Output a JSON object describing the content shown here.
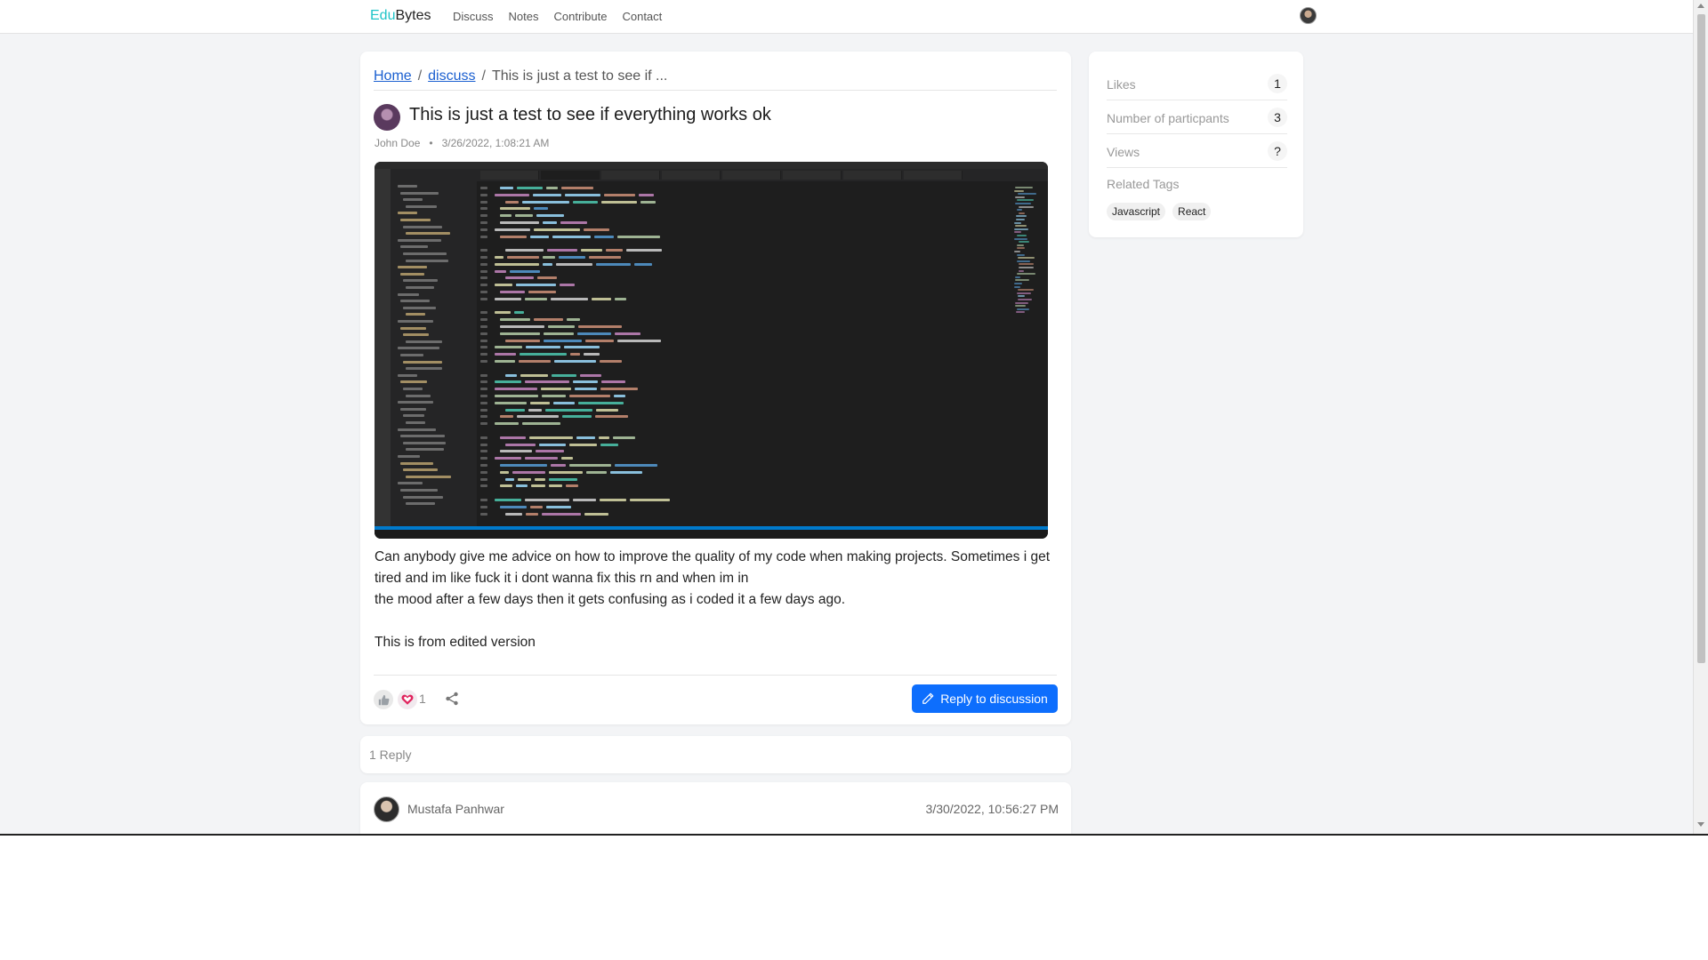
{
  "nav": {
    "brand_prefix": "Edu",
    "brand_suffix": "Bytes",
    "links": [
      "Discuss",
      "Notes",
      "Contribute",
      "Contact"
    ]
  },
  "breadcrumb": {
    "home": "Home",
    "discuss": "discuss",
    "current": "This is just a test to see if ..."
  },
  "post": {
    "title": "This is just a test to see if everything works ok",
    "author": "John Doe",
    "date": "3/26/2022, 1:08:21 AM",
    "body_line1": "Can anybody give me advice on how to improve the quality of my code when making projects. Sometimes i get tired and im like fuck it i dont wanna fix this rn and when im in",
    "body_line2": "the mood after a few days then it gets confusing as i coded it a few days ago.",
    "body_line3": "This is from edited version",
    "heart_count": "1",
    "reply_button": "Reply to discussion"
  },
  "replies": {
    "count_label": "1 Reply",
    "items": [
      {
        "author": "Mustafa Panhwar",
        "time": "3/30/2022, 10:56:27 PM"
      }
    ]
  },
  "sidebar": {
    "stats": [
      {
        "label": "Likes",
        "value": "1"
      },
      {
        "label": "Number of particpants",
        "value": "3"
      },
      {
        "label": "Views",
        "value": "?"
      }
    ],
    "tags_label": "Related Tags",
    "tags": [
      "Javascript",
      "React"
    ]
  },
  "colors": {
    "brand_accent": "#20c4c8",
    "primary_button": "#0d6efd",
    "heart": "#e0245e"
  }
}
